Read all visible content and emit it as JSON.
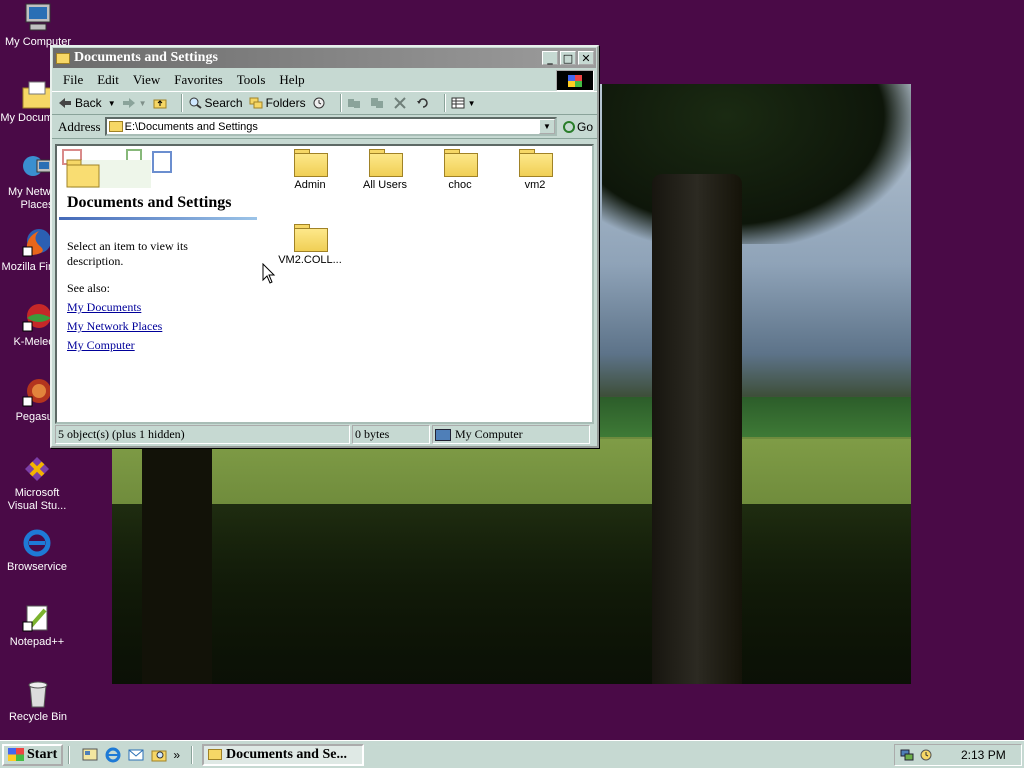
{
  "desktop": {
    "icons": [
      {
        "label": "My Computer",
        "icon": "my-computer-icon"
      },
      {
        "label": "My Documents",
        "icon": "my-documents-icon"
      },
      {
        "label": "My Network\nPlaces",
        "icon": "network-places-icon"
      },
      {
        "label": "Mozilla Firefox",
        "icon": "firefox-icon"
      },
      {
        "label": "K-Meleon",
        "icon": "k-meleon-icon"
      },
      {
        "label": "Pegasus",
        "icon": "pegasus-icon"
      },
      {
        "label": "Microsoft\nVisual Stu...",
        "icon": "visual-studio-icon"
      },
      {
        "label": "Browservice",
        "icon": "internet-explorer-icon"
      },
      {
        "label": "Notepad++",
        "icon": "notepad-plus-plus-icon"
      },
      {
        "label": "Recycle Bin",
        "icon": "recycle-bin-icon"
      }
    ]
  },
  "window": {
    "title": "Documents and Settings",
    "controls": {
      "minimize": "_",
      "maximize": "□",
      "close": "✕"
    },
    "menu": [
      "File",
      "Edit",
      "View",
      "Favorites",
      "Tools",
      "Help"
    ],
    "toolbar": {
      "back": "Back",
      "search": "Search",
      "folders": "Folders"
    },
    "address": {
      "label": "Address",
      "value": "E:\\Documents and Settings",
      "go": "Go"
    },
    "side": {
      "title": "Documents and Settings",
      "description": "Select an item to view its description.",
      "see_also": "See also:",
      "links": [
        "My Documents",
        "My Network Places",
        "My Computer"
      ]
    },
    "files": [
      {
        "name": "Admin"
      },
      {
        "name": "All Users"
      },
      {
        "name": "choc"
      },
      {
        "name": "vm2"
      },
      {
        "name": "VM2.COLL..."
      }
    ],
    "status": {
      "objects": "5 object(s) (plus 1 hidden)",
      "size": "0 bytes",
      "zone": "My Computer"
    }
  },
  "taskbar": {
    "start": "Start",
    "chevron": "»",
    "task": "Documents and Se...",
    "clock": "2:13 PM"
  },
  "colors": {
    "desktop": "#4a0a47",
    "window_face": "#c6d9d2",
    "link": "#00009a"
  }
}
